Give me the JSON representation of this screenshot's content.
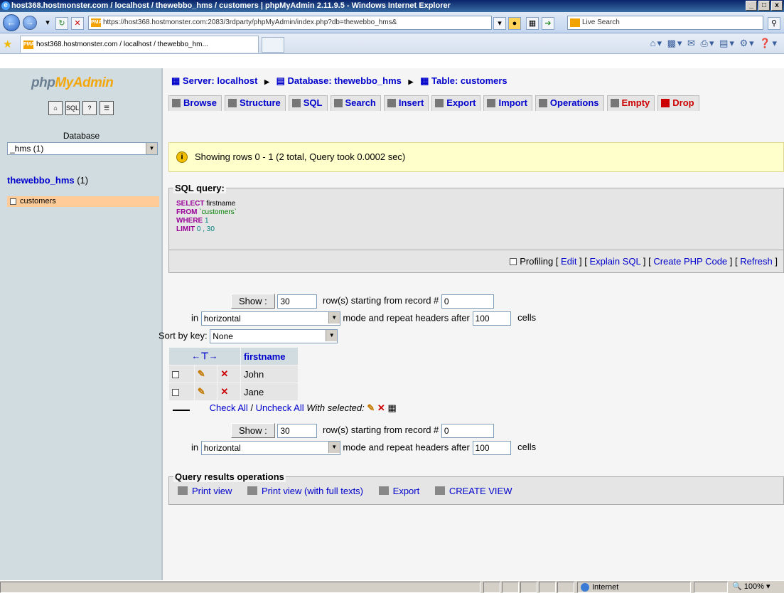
{
  "window": {
    "title": "host368.hostmonster.com / localhost / thewebbo_hms / customers | phpMyAdmin 2.11.9.5 - Windows Internet Explorer",
    "address": "https://host368.hostmonster.com:2083/3rdparty/phpMyAdmin/index.php?db=thewebbo_hms&",
    "search_placeholder": "Live Search",
    "tab_title": "host368.hostmonster.com / localhost / thewebbo_hm...",
    "status_zone": "Internet",
    "zoom": "100%"
  },
  "sidebar": {
    "logo_pre": "php",
    "logo_post": "MyAdmin",
    "database_label": "Database",
    "database_selected": "_hms (1)",
    "db_name": "thewebbo_hms",
    "db_count": "(1)",
    "tables": [
      {
        "label": "customers"
      }
    ]
  },
  "breadcrumb": {
    "server": "Server: localhost",
    "database": "Database: thewebbo_hms",
    "table": "Table: customers"
  },
  "tabs": [
    {
      "label": "Browse",
      "icon": "browse-icon"
    },
    {
      "label": "Structure",
      "icon": "structure-icon"
    },
    {
      "label": "SQL",
      "icon": "sql-icon"
    },
    {
      "label": "Search",
      "icon": "search-icon"
    },
    {
      "label": "Insert",
      "icon": "insert-icon"
    },
    {
      "label": "Export",
      "icon": "export-icon"
    },
    {
      "label": "Import",
      "icon": "import-icon"
    },
    {
      "label": "Operations",
      "icon": "operations-icon"
    },
    {
      "label": "Empty",
      "icon": "empty-icon"
    },
    {
      "label": "Drop",
      "icon": "drop-icon"
    }
  ],
  "notice": "Showing rows 0 - 1 (2 total, Query took 0.0002 sec)",
  "sql": {
    "legend": "SQL query:",
    "line1_kw": "SELECT",
    "line1_rest": " firstname",
    "line2_kw": "FROM",
    "line2_rest": " `customers`",
    "line3_kw": "WHERE",
    "line3_rest": " 1",
    "line4_kw": "LIMIT",
    "line4_rest": " 0 , 30",
    "profiling": "Profiling",
    "edit": "Edit",
    "explain": "Explain SQL",
    "create_php": "Create PHP Code",
    "refresh": "Refresh"
  },
  "nav": {
    "show_label": "Show :",
    "rows_value": "30",
    "rows_text": "row(s) starting from record #",
    "start_value": "0",
    "in_text": "in",
    "mode_value": "horizontal",
    "mode_text": "mode and repeat headers after",
    "repeat_value": "100",
    "cells_text": "cells",
    "sort_label": "Sort by key:",
    "sort_value": "None"
  },
  "results": {
    "column": "firstname",
    "rows": [
      {
        "firstname": "John"
      },
      {
        "firstname": "Jane"
      }
    ],
    "check_all": "Check All",
    "uncheck_all": "Uncheck All",
    "with_selected": "With selected:"
  },
  "operations": {
    "legend": "Query results operations",
    "print_view": "Print view",
    "print_full": "Print view (with full texts)",
    "export": "Export",
    "create_view": "CREATE VIEW"
  }
}
